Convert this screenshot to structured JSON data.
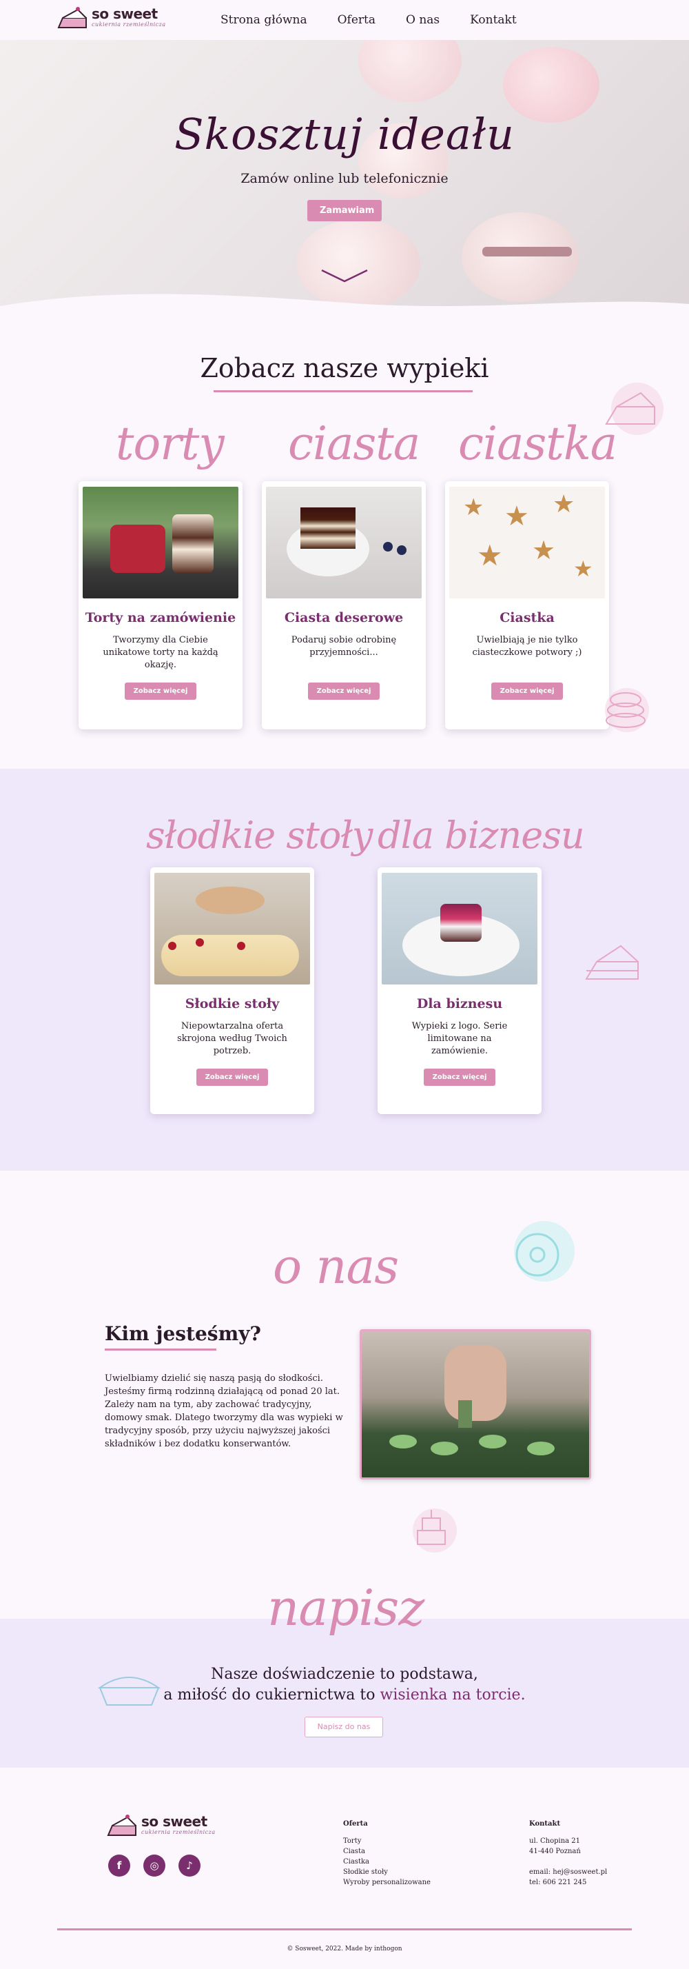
{
  "nav": {
    "brand": "so sweet",
    "brand_sub": "cukiernia rzemieślnicza",
    "items": [
      "Strona główna",
      "Oferta",
      "O nas",
      "Kontakt"
    ]
  },
  "hero": {
    "title": "Skosztuj ideału",
    "subtitle": "Zamów online lub telefonicznie",
    "button": "Zamawiam"
  },
  "products": {
    "title": "Zobacz nasze wypieki",
    "cards": [
      {
        "script": "torty",
        "title": "Torty na zamówienie",
        "desc": "Tworzymy dla Ciebie unikatowe torty na każdą okazję.",
        "button": "Zobacz więcej"
      },
      {
        "script": "ciasta",
        "title": "Ciasta deserowe",
        "desc": "Podaruj sobie odrobinę przyjemności...",
        "button": "Zobacz więcej"
      },
      {
        "script": "ciastka",
        "title": "Ciastka",
        "desc": "Uwielbiają je nie tylko ciasteczkowe potwory ;)",
        "button": "Zobacz więcej"
      }
    ],
    "cards2": [
      {
        "script": "słodkie stoły",
        "title": "Słodkie stoły",
        "desc": "Niepowtarzalna oferta skrojona według Twoich potrzeb.",
        "button": "Zobacz więcej"
      },
      {
        "script": "dla biznesu",
        "title": "Dla biznesu",
        "desc": "Wypieki z logo. Serie limitowane na zamówienie.",
        "button": "Zobacz więcej"
      }
    ]
  },
  "about": {
    "script": "o nas",
    "heading": "Kim jesteśmy?",
    "text": "Uwielbiamy dzielić się naszą pasją do słodkości. Jesteśmy firmą rodzinną działającą od ponad 20 lat. Zależy nam na tym, aby zachować tradycyjny, domowy smak. Dlatego tworzymy dla was wypieki w tradycyjny sposób, przy użyciu najwyższej jakości składników i bez dodatku konserwantów."
  },
  "contact": {
    "script": "napisz",
    "line1": "Nasze doświadczenie to podstawa,",
    "line2_a": "a miłość do cukiernictwa to ",
    "line2_b": "wisienka na torcie.",
    "button": "Napisz do nas"
  },
  "footer": {
    "brand": "so sweet",
    "brand_sub": "cukiernia rzemieślnicza",
    "offer_head": "Oferta",
    "offer_items": [
      "Torty",
      "Ciasta",
      "Ciastka",
      "Słodkie stoły",
      "Wyroby personalizowane"
    ],
    "contact_head": "Kontakt",
    "address1": "ul. Chopina 21",
    "address2": "41-440 Poznań",
    "email": "email: hej@sosweet.pl",
    "phone": "tel: 606 221 245",
    "copyright": "© Sosweet, 2022. Made by inthogon"
  },
  "colors": {
    "accent": "#d98bb1",
    "accent_dark": "#7a2e6e",
    "band": "#efe8fb"
  }
}
